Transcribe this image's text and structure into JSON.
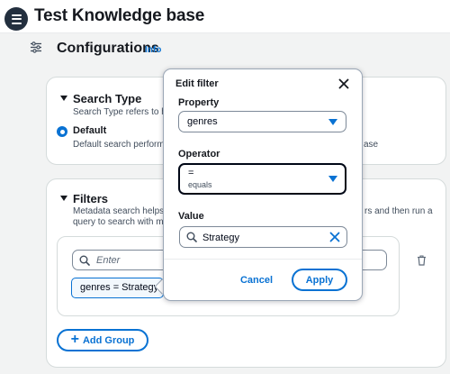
{
  "app": {
    "title": "Test Knowledge base"
  },
  "config": {
    "title": "Configurations",
    "info": "Info"
  },
  "search_type": {
    "title": "Search Type",
    "description": "Search Type refers to ho",
    "option_label": "Default",
    "option_description": "Default search performs",
    "option_description_tail": "ase"
  },
  "filters": {
    "title": "Filters",
    "description_line1": "Metadata search helps y",
    "description_line1_tail": "rs and then run a",
    "description_line2": "query to search with me",
    "search_placeholder": "Enter",
    "token_label": "genres = Strategy",
    "add_group_label": "Add Group"
  },
  "edit_filter": {
    "title": "Edit filter",
    "property_label": "Property",
    "property_value": "genres",
    "operator_label": "Operator",
    "operator_symbol": "=",
    "operator_name": "equals",
    "value_label": "Value",
    "value": "Strategy",
    "cancel_label": "Cancel",
    "apply_label": "Apply"
  },
  "colors": {
    "accent": "#0972d3",
    "dark": "#232f3e",
    "border": "#7d8998"
  },
  "icons": [
    "menu-icon",
    "settings-icon",
    "caret-down-icon",
    "search-icon",
    "trash-icon",
    "plus-icon",
    "close-icon",
    "dropdown-caret-icon",
    "clear-icon"
  ]
}
